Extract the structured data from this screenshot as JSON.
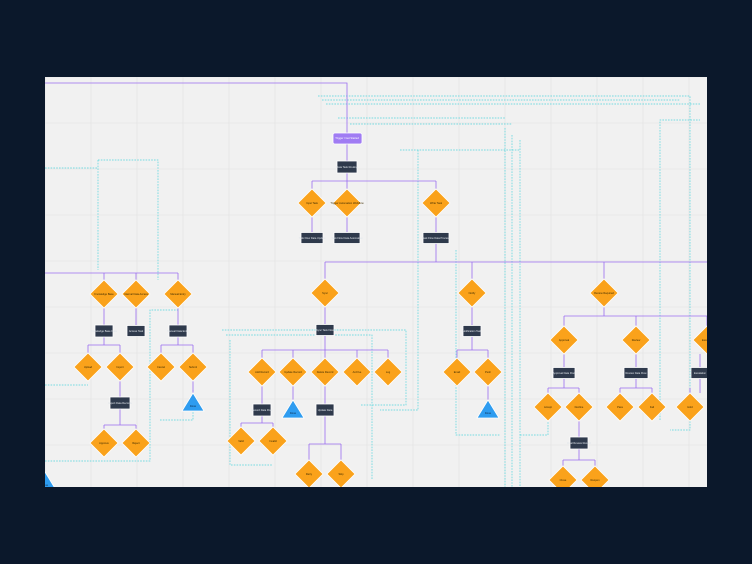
{
  "colors": {
    "background": "#0b182b",
    "canvas": "#f1f1f1",
    "connector": "#9b6cf0",
    "start_node": "#a07cf3",
    "decision": "#faa21b",
    "process": "#2f3a4c",
    "terminal": "#2e9cf0",
    "dashed_group": "#4fd4dc"
  },
  "diagram": {
    "start": "Trigger / Get Started",
    "nodes": {
      "p1": "Data Task Routing",
      "d1": "Input Task",
      "d2": "Trigger Automation Workflow",
      "d3": "Write Task",
      "p2": "Task Flow Data Update",
      "p3": "Task Flow Data Automation",
      "p4": "Task Flow Data Process",
      "dl1": "Knowledge Base",
      "dl2": "Internal Data Access",
      "dl3": "Manual Entry",
      "pl1": "Knowledge Base Data",
      "pl2": "Access Task",
      "pl3": "Manual Data Entry",
      "dl4": "Upload",
      "dl5": "Import",
      "dl6": "Cancel",
      "dl7": "Submit",
      "tl1": "Done",
      "pl4": "Import Data Records",
      "dl8": "Approve",
      "dl9": "Reject",
      "dm1": "Sync",
      "pm1": "Sync Task Flow",
      "dm2": "Add Record",
      "dm3": "Update Record",
      "dm4": "Delete Record",
      "dm5": "Archive",
      "dm6": "Log",
      "pm2": "Record Data Flow",
      "tm1": "Done",
      "pm3": "Update Data",
      "dm7": "Valid",
      "dm8": "Invalid",
      "dm9": "Retry",
      "dm10": "Skip",
      "dc1": "Notify",
      "pc1": "Notification Task",
      "dc2": "Email",
      "dc3": "Push",
      "tc1": "Done",
      "dr1": "Review Required",
      "dr2": "Approval",
      "dr3": "Review",
      "dr4": "Escalate",
      "pr1": "Approval Data Flow",
      "pr2": "Review Data Flow",
      "pr3": "Escalation",
      "dr5": "Accept",
      "dr6": "Decline",
      "dr7": "Pass",
      "dr8": "Fail",
      "dr9": "Hold",
      "pr4": "Final Review Record",
      "dr10": "Close",
      "dr11": "Reopen",
      "tb1": "Done"
    }
  }
}
